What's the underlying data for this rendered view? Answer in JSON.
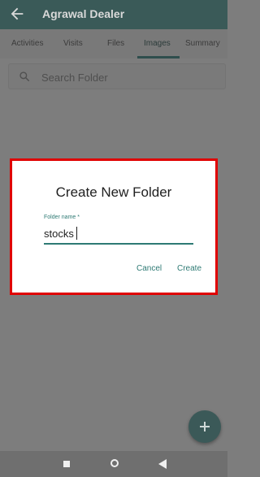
{
  "appbar": {
    "title": "Agrawal Dealer"
  },
  "tabs": [
    {
      "label": "Activities"
    },
    {
      "label": "Visits"
    },
    {
      "label": "Files"
    },
    {
      "label": "Images",
      "active": true
    },
    {
      "label": "Summary"
    }
  ],
  "search": {
    "placeholder": "Search Folder",
    "value": ""
  },
  "dialog": {
    "title": "Create New Folder",
    "field_label": "Folder name *",
    "field_value": "stocks",
    "cancel_label": "Cancel",
    "create_label": "Create"
  },
  "colors": {
    "accent": "#2e7a74",
    "appbar": "#3a5a58",
    "highlight": "#e00000"
  },
  "icons": {
    "back": "arrow-left",
    "search": "magnifier",
    "fab": "plus",
    "nav": [
      "square",
      "circle",
      "triangle-back"
    ]
  }
}
